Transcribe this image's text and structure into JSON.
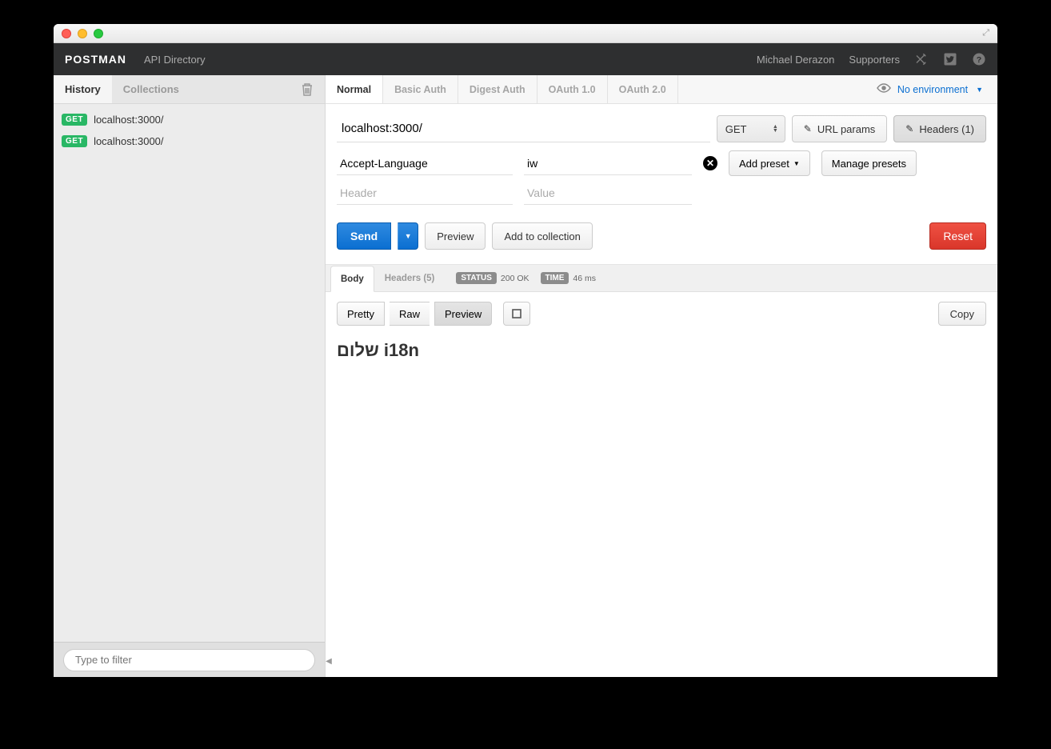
{
  "brand": "POSTMAN",
  "topbar": {
    "api_directory": "API Directory",
    "user": "Michael Derazon",
    "supporters": "Supporters"
  },
  "sidebar": {
    "tabs": {
      "history": "History",
      "collections": "Collections"
    },
    "items": [
      {
        "method": "GET",
        "url": "localhost:3000/"
      },
      {
        "method": "GET",
        "url": "localhost:3000/"
      }
    ],
    "filter_placeholder": "Type to filter"
  },
  "auth_tabs": {
    "normal": "Normal",
    "basic": "Basic Auth",
    "digest": "Digest Auth",
    "oauth1": "OAuth 1.0",
    "oauth2": "OAuth 2.0"
  },
  "environment": {
    "label": "No environment"
  },
  "request": {
    "url": "localhost:3000/",
    "method": "GET",
    "url_params_btn": "URL params",
    "headers_btn": "Headers (1)",
    "headers": [
      {
        "key": "Accept-Language",
        "value": "iw"
      }
    ],
    "header_key_placeholder": "Header",
    "header_value_placeholder": "Value",
    "add_preset": "Add preset",
    "manage_presets": "Manage presets",
    "send": "Send",
    "preview": "Preview",
    "add_to_collection": "Add to collection",
    "reset": "Reset"
  },
  "response": {
    "body_tab": "Body",
    "headers_tab": "Headers (5)",
    "status_label": "STATUS",
    "status_value": "200 OK",
    "time_label": "TIME",
    "time_value": "46 ms",
    "pretty": "Pretty",
    "raw": "Raw",
    "preview": "Preview",
    "copy": "Copy",
    "content": "שלום i18n"
  }
}
